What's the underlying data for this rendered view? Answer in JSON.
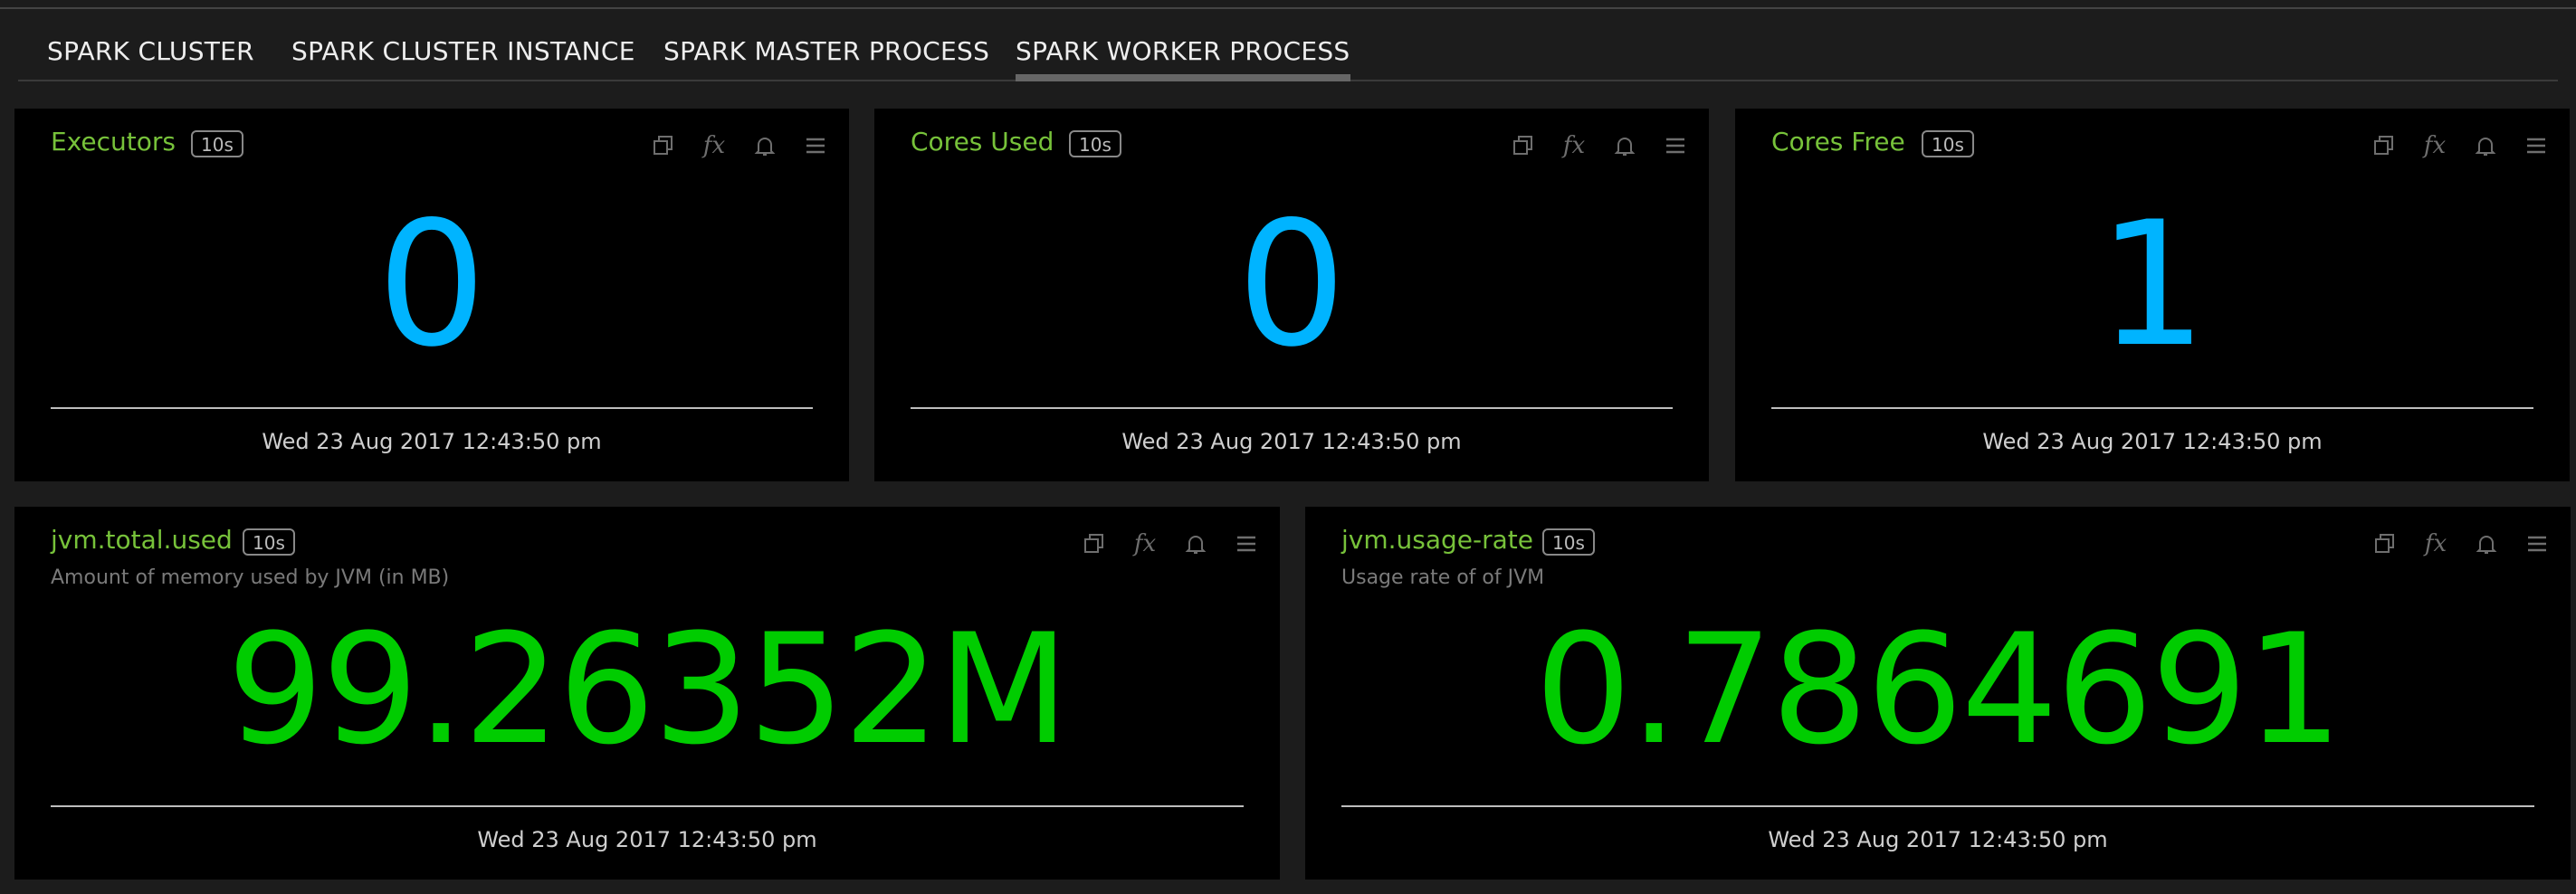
{
  "tabs": [
    {
      "label": "SPARK CLUSTER"
    },
    {
      "label": "SPARK CLUSTER INSTANCE"
    },
    {
      "label": "SPARK MASTER PROCESS"
    },
    {
      "label": "SPARK WORKER PROCESS"
    }
  ],
  "active_tab": "SPARK WORKER PROCESS",
  "panels": {
    "executors": {
      "title": "Executors",
      "interval": "10s",
      "value": "0",
      "timestamp": "Wed 23 Aug 2017 12:43:50 pm"
    },
    "cores_used": {
      "title": "Cores Used",
      "interval": "10s",
      "value": "0",
      "timestamp": "Wed 23 Aug 2017 12:43:50 pm"
    },
    "cores_free": {
      "title": "Cores Free",
      "interval": "10s",
      "value": "1",
      "timestamp": "Wed 23 Aug 2017 12:43:50 pm"
    },
    "jvm_total_used": {
      "title": "jvm.total.used",
      "interval": "10s",
      "subtitle": "Amount of memory used by JVM (in MB)",
      "value": "99.26352M",
      "timestamp": "Wed 23 Aug 2017 12:43:50 pm"
    },
    "jvm_usage_rate": {
      "title": "jvm.usage-rate",
      "interval": "10s",
      "subtitle": "Usage rate of of JVM",
      "value": "0.7864691",
      "timestamp": "Wed 23 Aug 2017 12:43:50 pm"
    }
  },
  "toolbar_icons": [
    "copy-icon",
    "function-icon",
    "bell-icon",
    "menu-icon"
  ],
  "tool_fx_label": "fx",
  "colors": {
    "title": "#77c23a",
    "value_blue": "#00b4ff",
    "value_green": "#00cc00",
    "panel_bg": "#000000",
    "page_bg": "#1c1c1c"
  }
}
